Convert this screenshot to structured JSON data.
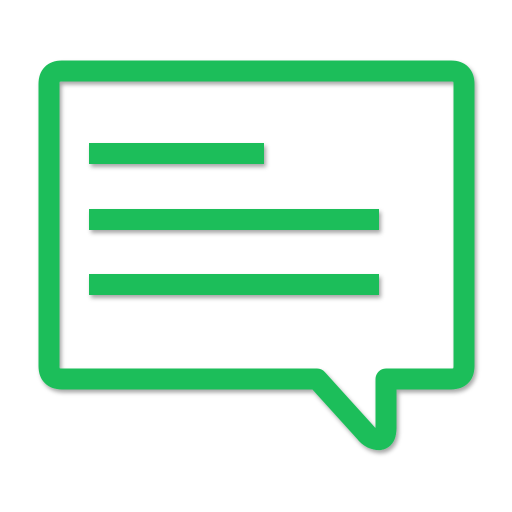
{
  "icon": {
    "name": "message-bubble-icon",
    "accent_color": "#1fbe5a",
    "background_color": "#ffffff",
    "line_count": 3
  }
}
